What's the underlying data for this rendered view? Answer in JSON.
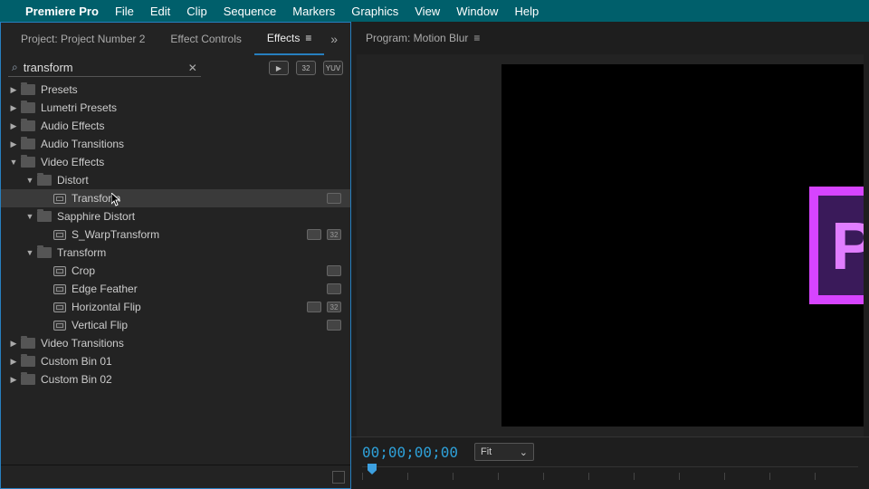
{
  "menubar": {
    "appname": "Premiere Pro",
    "items": [
      "File",
      "Edit",
      "Clip",
      "Sequence",
      "Markers",
      "Graphics",
      "View",
      "Window",
      "Help"
    ]
  },
  "effects_panel": {
    "tabs": {
      "project": "Project: Project Number 2",
      "effect_controls": "Effect Controls",
      "effects": "Effects"
    },
    "search_value": "transform",
    "toolbar_badges": [
      "▶",
      "32",
      "YUV"
    ],
    "tree": [
      {
        "type": "folder",
        "label": "Presets",
        "depth": 0,
        "expanded": false
      },
      {
        "type": "folder",
        "label": "Lumetri Presets",
        "depth": 0,
        "expanded": false
      },
      {
        "type": "folder",
        "label": "Audio Effects",
        "depth": 0,
        "expanded": false
      },
      {
        "type": "folder",
        "label": "Audio Transitions",
        "depth": 0,
        "expanded": false
      },
      {
        "type": "folder",
        "label": "Video Effects",
        "depth": 0,
        "expanded": true
      },
      {
        "type": "folder",
        "label": "Distort",
        "depth": 1,
        "expanded": true
      },
      {
        "type": "effect",
        "label": "Transform",
        "depth": 2,
        "selected": true,
        "tags": [
          "fx"
        ],
        "cursor": true
      },
      {
        "type": "folder",
        "label": "Sapphire Distort",
        "depth": 1,
        "expanded": true
      },
      {
        "type": "effect",
        "label": "S_WarpTransform",
        "depth": 2,
        "tags": [
          "fx",
          "32"
        ]
      },
      {
        "type": "folder",
        "label": "Transform",
        "depth": 1,
        "expanded": true
      },
      {
        "type": "effect",
        "label": "Crop",
        "depth": 2,
        "tags": [
          "fx"
        ]
      },
      {
        "type": "effect",
        "label": "Edge Feather",
        "depth": 2,
        "tags": [
          "fx"
        ]
      },
      {
        "type": "effect",
        "label": "Horizontal Flip",
        "depth": 2,
        "tags": [
          "fx",
          "32"
        ]
      },
      {
        "type": "effect",
        "label": "Vertical Flip",
        "depth": 2,
        "tags": [
          "fx"
        ]
      },
      {
        "type": "folder",
        "label": "Video Transitions",
        "depth": 0,
        "expanded": false
      },
      {
        "type": "folder",
        "label": "Custom Bin 01",
        "depth": 0,
        "expanded": false
      },
      {
        "type": "folder",
        "label": "Custom Bin 02",
        "depth": 0,
        "expanded": false
      }
    ]
  },
  "program_panel": {
    "tab_label": "Program: Motion Blur",
    "logo_text": "Pr",
    "timecode": "00;00;00;00",
    "zoom_select": "Fit"
  }
}
